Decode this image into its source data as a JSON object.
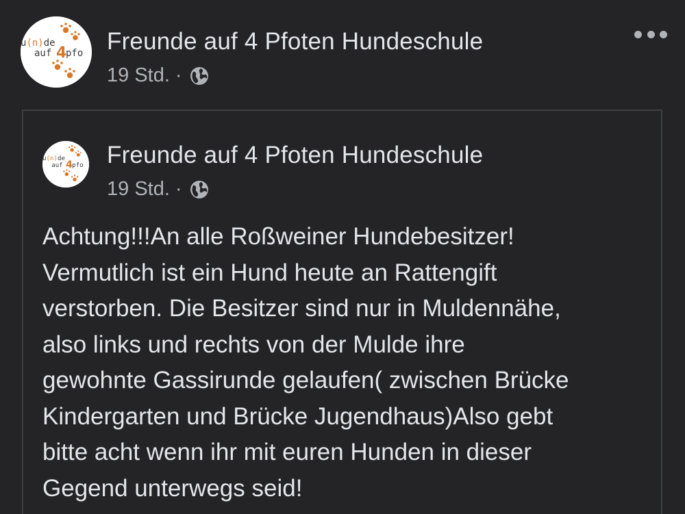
{
  "outer_post": {
    "page_name": "Freunde auf 4 Pfoten Hundeschule",
    "time": "19 Std.",
    "separator": "·",
    "privacy_icon": "globe-icon",
    "more_icon": "more-options-icon"
  },
  "avatar": {
    "logo_text_line1": "u(n)de",
    "logo_text_line2": "auf",
    "logo_number": "4",
    "logo_text_line3": "pfo",
    "accent_color": "#d9782d"
  },
  "shared_post": {
    "page_name": "Freunde auf 4 Pfoten Hundeschule",
    "time": "19 Std.",
    "separator": "·",
    "privacy_icon": "globe-icon",
    "text_lines": [
      "Achtung!!!An alle Roßweiner Hundebesitzer!",
      "Vermutlich ist ein Hund heute an Rattengift",
      "verstorben. Die Besitzer sind nur in Muldennähe,",
      "also links und rechts von der Mulde ihre",
      "gewohnte Gassirunde gelaufen( zwischen Brücke",
      "Kindergarten und Brücke Jugendhaus)Also gebt",
      "bitte acht wenn ihr mit euren Hunden in dieser",
      "Gegend unterwegs seid!"
    ]
  },
  "colors": {
    "background": "#242426",
    "text_primary": "#e4e6eb",
    "text_secondary": "#b0b3b8",
    "border": "#3e4042"
  }
}
